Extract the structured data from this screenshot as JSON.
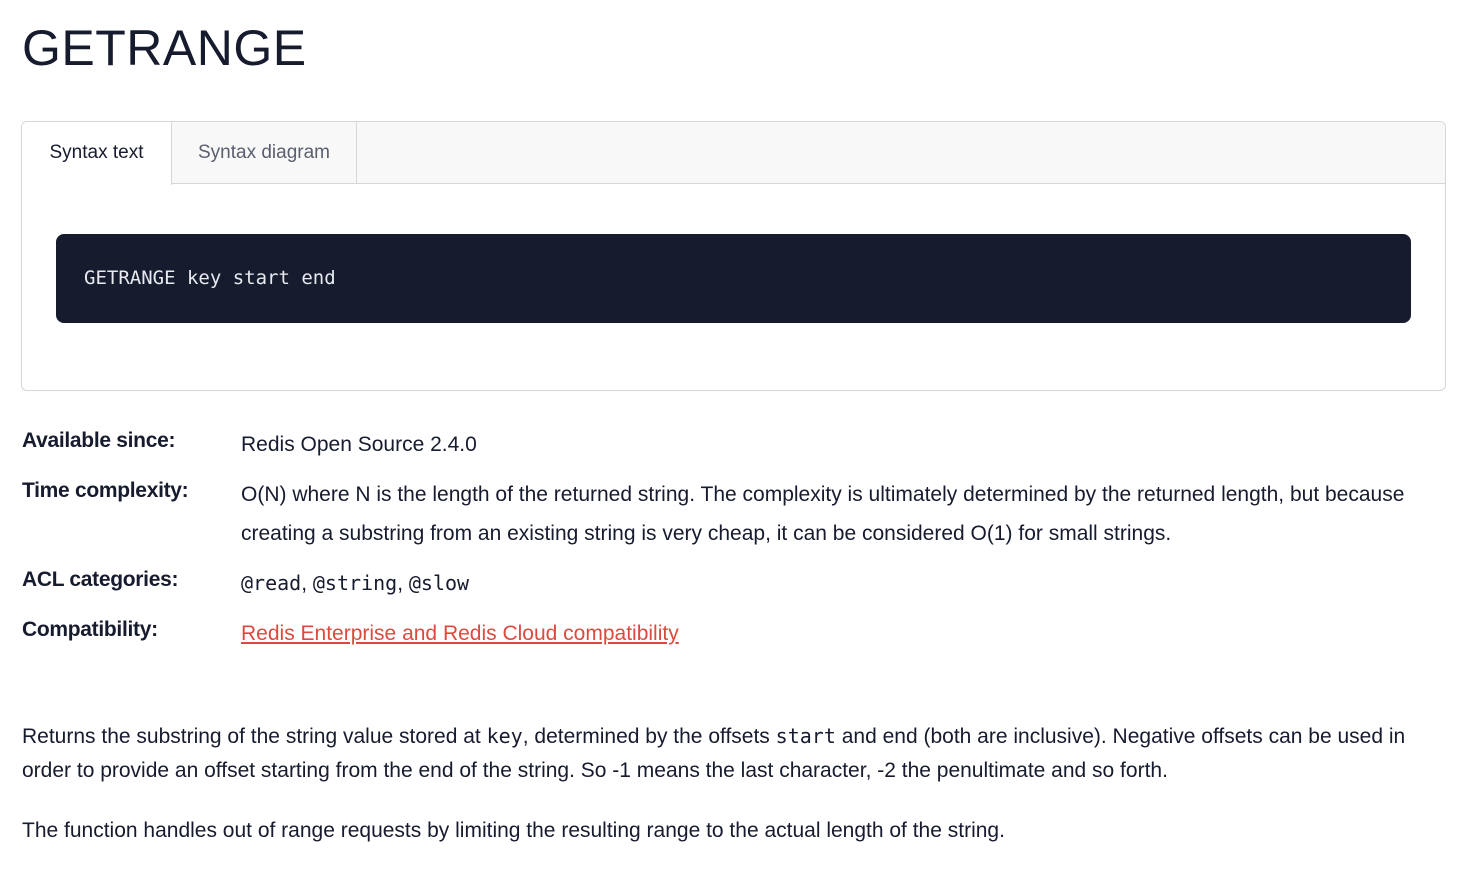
{
  "page": {
    "title": "GETRANGE"
  },
  "syntax": {
    "tabs": [
      {
        "label": "Syntax text",
        "active": true
      },
      {
        "label": "Syntax diagram",
        "active": false
      }
    ],
    "code": "GETRANGE key start end"
  },
  "meta": {
    "available_since": {
      "label": "Available since:",
      "value": "Redis Open Source 2.4.0"
    },
    "time_complexity": {
      "label": "Time complexity:",
      "value": "O(N) where N is the length of the returned string. The complexity is ultimately determined by the returned length, but because creating a substring from an existing string is very cheap, it can be considered O(1) for small strings."
    },
    "acl_categories": {
      "label": "ACL categories:",
      "values": [
        "@read",
        "@string",
        "@slow"
      ],
      "separator": ", "
    },
    "compatibility": {
      "label": "Compatibility:",
      "link_text": "Redis Enterprise and Redis Cloud compatibility"
    }
  },
  "description": {
    "p1": {
      "t1": "Returns the substring of the string value stored at ",
      "c1": "key",
      "t2": ", determined by the offsets ",
      "c2": "start",
      "t3": " and ",
      "c3": "end",
      "t4": " (both are inclusive). Negative offsets can be used in order to provide an offset starting from the end of the string. So -1 means the last character, -2 the penultimate and so forth."
    },
    "p2": "The function handles out of range requests by limiting the resulting range to the actual length of the string."
  },
  "colors": {
    "text": "#161b2e",
    "code_bg": "#161b2e",
    "link": "#dc4a3d",
    "border": "#d6d7db"
  }
}
